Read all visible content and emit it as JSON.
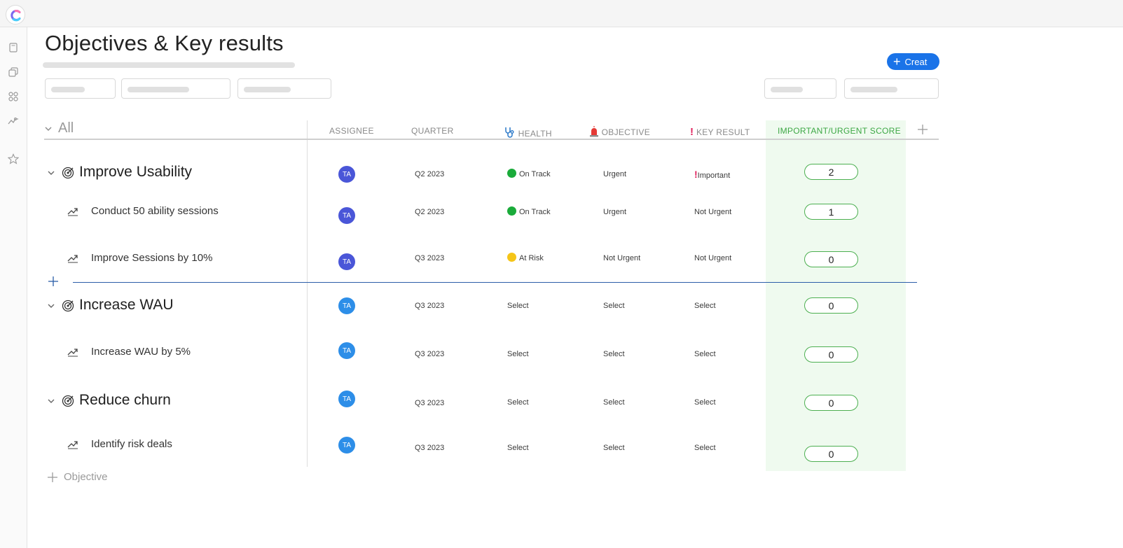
{
  "page": {
    "title": "Objectives & Key results"
  },
  "toolbar": {
    "create_label": "Creat"
  },
  "group": {
    "label": "All"
  },
  "columns": {
    "assignee": "ASSIGNEE",
    "quarter": "QUARTER",
    "health": "HEALTH",
    "objective": "OBJECTIVE",
    "key_result": "KEY RESULT",
    "score": "IMPORTANT/URGENT SCORE"
  },
  "rows": [
    {
      "type": "objective",
      "name": "Improve Usability",
      "assignee": "TA",
      "quarter": "Q2 2023",
      "health": "On Track",
      "objective": "Urgent",
      "key_result": "Important",
      "score": "2"
    },
    {
      "type": "key_result",
      "name": "Conduct 50 ability sessions",
      "assignee": "TA",
      "quarter": "Q2 2023",
      "health": "On Track",
      "objective": "Urgent",
      "key_result": "Not Urgent",
      "score": "1"
    },
    {
      "type": "key_result",
      "name": "Improve Sessions by 10%",
      "assignee": "TA",
      "quarter": "Q3 2023",
      "health": "At Risk",
      "objective": "Not Urgent",
      "key_result": "Not Urgent",
      "score": "0"
    },
    {
      "type": "objective",
      "name": "Increase WAU",
      "assignee": "TA",
      "quarter": "Q3 2023",
      "health": "Select",
      "objective": "Select",
      "key_result": "Select",
      "score": "0"
    },
    {
      "type": "key_result",
      "name": "Increase WAU by 5%",
      "assignee": "TA",
      "quarter": "Q3 2023",
      "health": "Select",
      "objective": "Select",
      "key_result": "Select",
      "score": "0"
    },
    {
      "type": "objective",
      "name": "Reduce churn",
      "assignee": "TA",
      "quarter": "Q3 2023",
      "health": "Select",
      "objective": "Select",
      "key_result": "Select",
      "score": "0"
    },
    {
      "type": "key_result",
      "name": "Identify risk deals",
      "assignee": "TA",
      "quarter": "Q3 2023",
      "health": "Select",
      "objective": "Select",
      "key_result": "Select",
      "score": "0"
    }
  ],
  "footer": {
    "add_objective_label": "Objective"
  },
  "colors": {
    "accent": "#1a73e8",
    "on_track": "#1aab3a",
    "at_risk": "#f5c518",
    "important_mark": "#e0245e",
    "avatar_dark": "#4a56d8",
    "avatar_light": "#2d8ee8",
    "score_column_bg": "#effaef",
    "score_border": "#4caf50"
  }
}
